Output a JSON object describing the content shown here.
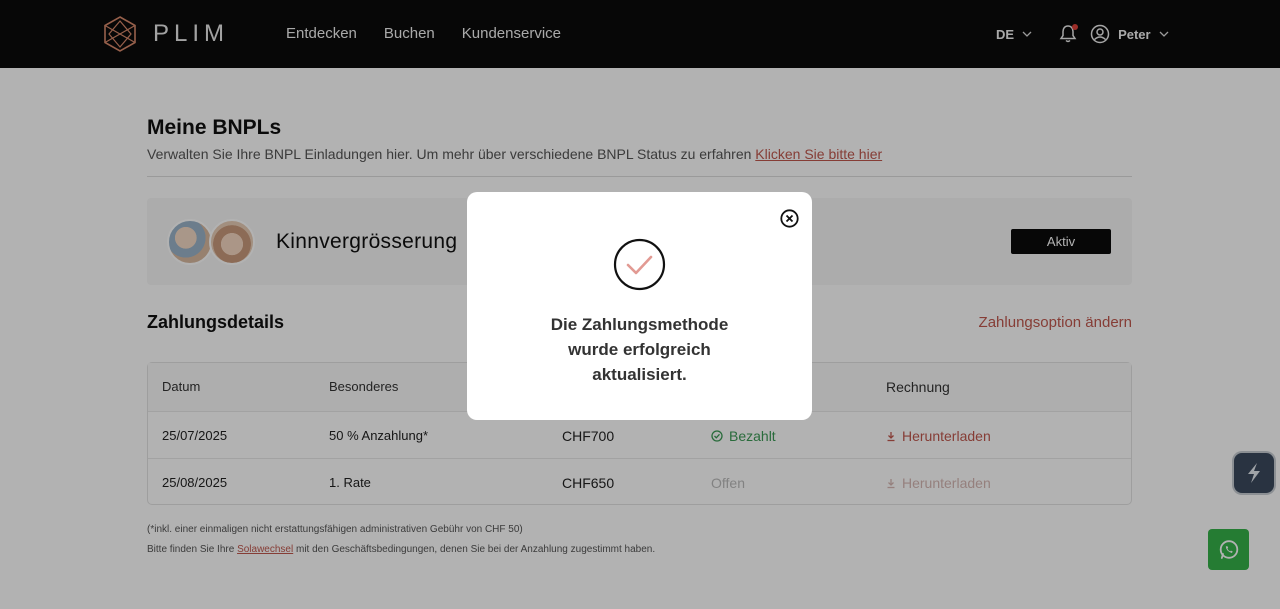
{
  "header": {
    "logo_text": "PLIM",
    "nav": [
      "Entdecken",
      "Buchen",
      "Kundenservice"
    ],
    "language": "DE",
    "user_name": "Peter"
  },
  "page": {
    "title": "Meine BNPLs",
    "subtitle": "Verwalten Sie Ihre BNPL Einladungen hier. Um mehr über verschiedene BNPL Status zu erfahren ",
    "subtitle_link": "Klicken Sie bitte hier"
  },
  "treatment": {
    "name": "Kinnvergrösserung",
    "status": "Aktiv"
  },
  "payments": {
    "title": "Zahlungsdetails",
    "change_option": "Zahlungsoption ändern",
    "columns": {
      "date": "Datum",
      "special": "Besonderes",
      "invoice": "Rechnung"
    },
    "rows": [
      {
        "date": "25/07/2025",
        "special": "50 % Anzahlung*",
        "amount": "CHF700",
        "status": "Bezahlt",
        "invoice": "Herunterladen"
      },
      {
        "date": "25/08/2025",
        "special": "1. Rate",
        "amount": "CHF650",
        "status": "Offen",
        "invoice": "Herunterladen"
      }
    ]
  },
  "footer": {
    "note": "(*inkl. einer einmaligen nicht erstattungsfähigen administrativen Gebühr von CHF 50)",
    "terms_prefix": "Bitte finden Sie Ihre ",
    "terms_link": "Solawechsel",
    "terms_suffix": " mit den Geschäftsbedingungen, denen Sie bei der Anzahlung zugestimmt haben."
  },
  "modal": {
    "message_line1": "Die Zahlungsmethode",
    "message_line2": "wurde erfolgreich",
    "message_line3": "aktualisiert."
  },
  "colors": {
    "accent": "#c0584e",
    "paid": "#3b9a55",
    "whatsapp": "#35b24a"
  }
}
